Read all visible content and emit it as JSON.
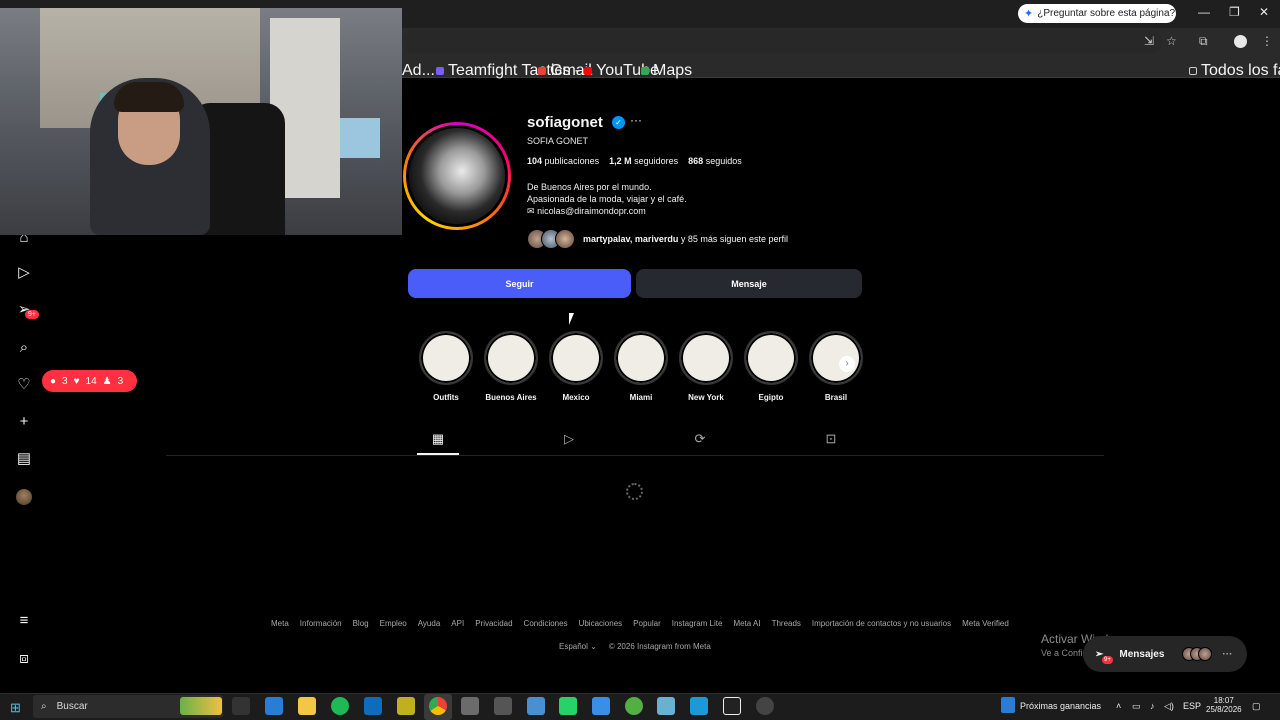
{
  "browser": {
    "ask_label": "¿Preguntar sobre esta página?",
    "bookmarks": [
      {
        "label": "Ad...",
        "icon": "bookmark-icon",
        "color": "#888888"
      },
      {
        "label": "Teamfight Tactics -...",
        "icon": "tft-icon",
        "color": "#7b5cff"
      },
      {
        "label": "Gmail",
        "icon": "gmail-icon",
        "color": "#ea4335"
      },
      {
        "label": "YouTube",
        "icon": "youtube-icon",
        "color": "#ff0000"
      },
      {
        "label": "Maps",
        "icon": "maps-icon",
        "color": "#34a853"
      }
    ],
    "all_bookmarks": "Todos los favoritos"
  },
  "nav": {
    "notifications_badge": "9+",
    "activity": {
      "comments": "3",
      "likes": "14",
      "follows": "3"
    }
  },
  "profile": {
    "username": "sofiagonet",
    "full_name": "SOFIA GONET",
    "posts_count": "104",
    "posts_label": "publicaciones",
    "followers_count": "1,2 M",
    "followers_label": "seguidores",
    "following_count": "868",
    "following_label": "seguidos",
    "bio_line1": "De Buenos Aires por el mundo.",
    "bio_line2": "Apasionada de la moda, viajar y el café.",
    "email": "nicolas@diraimondopr.com",
    "followed_by_names": "martypalav, mariverdu",
    "followed_by_rest": "y 85 más siguen este perfil",
    "follow_button": "Seguir",
    "message_button": "Mensaje"
  },
  "highlights": [
    {
      "label": "Outfits"
    },
    {
      "label": "Buenos Aires"
    },
    {
      "label": "Mexico"
    },
    {
      "label": "Miami"
    },
    {
      "label": "New York"
    },
    {
      "label": "Egipto"
    },
    {
      "label": "Brasil"
    }
  ],
  "footer": {
    "links": [
      "Meta",
      "Información",
      "Blog",
      "Empleo",
      "Ayuda",
      "API",
      "Privacidad",
      "Condiciones",
      "Ubicaciones",
      "Popular",
      "Instagram Lite",
      "Meta AI",
      "Threads",
      "Importación de contactos y no usuarios",
      "Meta Verified"
    ],
    "language": "Español",
    "copyright": "© 2026 Instagram from Meta"
  },
  "overlay": {
    "activate_title": "Activar Windows",
    "activate_sub": "Ve a Configuración para activar Windows.",
    "messages_label": "Mensajes",
    "messages_badge": "9+"
  },
  "taskbar": {
    "search_placeholder": "Buscar",
    "weather_label": "Próximas ganancias",
    "language": "ESP",
    "time": "18:07",
    "date": "25/8/2026"
  }
}
